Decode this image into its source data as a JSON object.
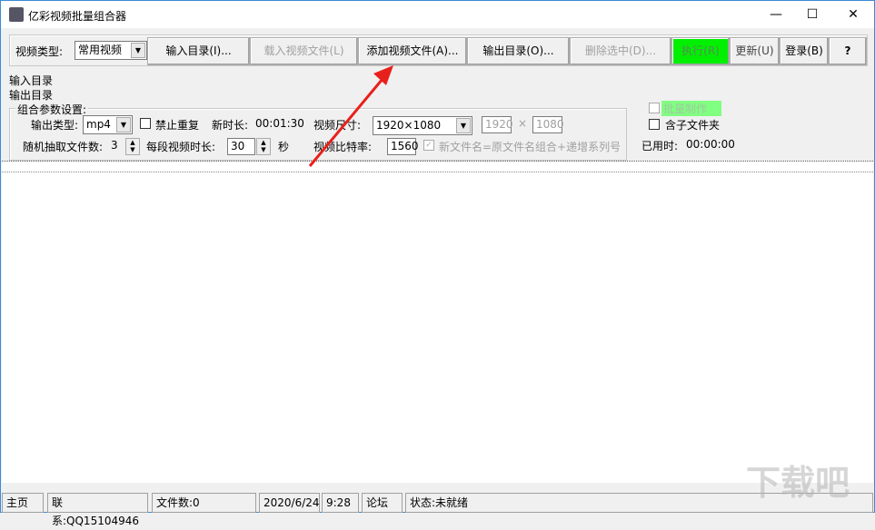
{
  "window": {
    "title": "亿彩视频批量组合器",
    "minimize": "—",
    "maximize": "☐",
    "close": "✕"
  },
  "toolbar": {
    "video_type_label": "视频类型:",
    "video_type_value": "常用视频",
    "input_dir": "输入目录(I)...",
    "load_file": "载入视频文件(L)",
    "add_file": "添加视频文件(A)...",
    "output_dir": "输出目录(O)...",
    "delete_selected": "删除选中(D)...",
    "execute": "执行(R)",
    "update": "更新(U)",
    "login": "登录(B)",
    "help": "?"
  },
  "paths": {
    "input": "输入目录",
    "output": "输出目录"
  },
  "settings": {
    "legend": "组合参数设置:",
    "output_type_label": "输出类型:",
    "output_type_value": "mp4",
    "no_repeat_label": "禁止重复",
    "new_duration_label": "新时长:",
    "new_duration_value": "00:01:30",
    "video_size_label": "视频尺寸:",
    "video_size_value": "1920×1080",
    "width": "1920",
    "times": "×",
    "height": "1080",
    "random_count_label": "随机抽取文件数:",
    "random_count_value": "3",
    "segment_label": "每段视频时长:",
    "segment_value": "30",
    "seconds": "秒",
    "bitrate_label": "视频比特率:",
    "bitrate_value": "1560",
    "naming_label": "新文件名=原文件名组合+递增系列号"
  },
  "right": {
    "batch_label": "批量制作",
    "subfolder_label": "含子文件夹",
    "elapsed_label": "已用时:",
    "elapsed_value": "00:00:00"
  },
  "colors": {
    "execute": "#00f000",
    "batch": "#80ff80",
    "arrow": "#e8201c"
  },
  "status": {
    "home": "主页",
    "contact": "联系:QQ15104946",
    "file_count": "文件数:0",
    "date": "2020/6/24",
    "time": "9:28",
    "forum": "论坛",
    "state": "状态:未就绪"
  },
  "watermark": "下载吧"
}
